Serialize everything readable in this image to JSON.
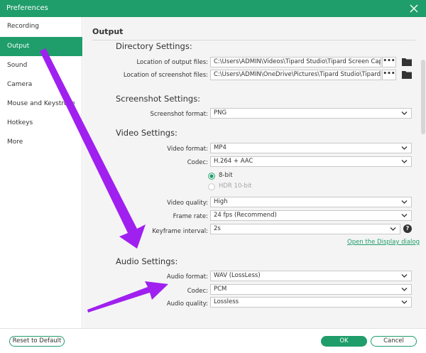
{
  "window": {
    "title": "Preferences"
  },
  "sidebar": {
    "items": [
      {
        "label": "Recording",
        "active": false
      },
      {
        "label": "Output",
        "active": true
      },
      {
        "label": "Sound",
        "active": false
      },
      {
        "label": "Camera",
        "active": false
      },
      {
        "label": "Mouse and Keystroke",
        "active": false
      },
      {
        "label": "Hotkeys",
        "active": false
      },
      {
        "label": "More",
        "active": false
      }
    ]
  },
  "output": {
    "title": "Output",
    "directory": {
      "title": "Directory Settings:",
      "output_files_label": "Location of output files:",
      "output_files_value": "C:\\Users\\ADMIN\\Videos\\Tipard Studio\\Tipard Screen Captu",
      "screenshot_files_label": "Location of screenshot files:",
      "screenshot_files_value": "C:\\Users\\ADMIN\\OneDrive\\Pictures\\Tipard Studio\\Tipard Sc",
      "browse_label": "•••"
    },
    "screenshot": {
      "title": "Screenshot Settings:",
      "format_label": "Screenshot format:",
      "format_value": "PNG"
    },
    "video": {
      "title": "Video Settings:",
      "format_label": "Video format:",
      "format_value": "MP4",
      "codec_label": "Codec:",
      "codec_value": "H.264 + AAC",
      "bit_8_label": "8-bit",
      "bit_hdr_label": "HDR 10-bit",
      "quality_label": "Video quality:",
      "quality_value": "High",
      "frame_rate_label": "Frame rate:",
      "frame_rate_value": "24 fps (Recommend)",
      "keyframe_label": "Keyframe interval:",
      "keyframe_value": "2s",
      "help_label": "?",
      "display_link": "Open the Display dialog"
    },
    "audio": {
      "title": "Audio Settings:",
      "format_label": "Audio format:",
      "format_value": "WAV (LossLess)",
      "codec_label": "Codec:",
      "codec_value": "PCM",
      "quality_label": "Audio quality:",
      "quality_value": "Lossless"
    }
  },
  "footer": {
    "reset_label": "Reset to Default",
    "ok_label": "OK",
    "cancel_label": "Cancel"
  },
  "colors": {
    "accent": "#1f9d6b",
    "arrow": "#a020f0"
  }
}
